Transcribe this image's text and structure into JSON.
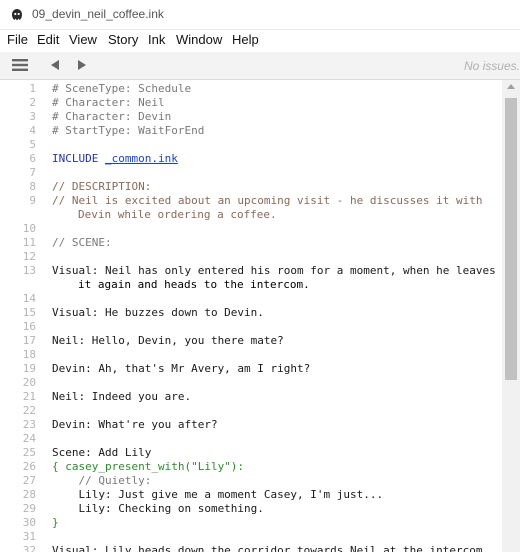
{
  "window": {
    "title": "09_devin_neil_coffee.ink"
  },
  "menu": [
    "File",
    "Edit",
    "View",
    "Story",
    "Ink",
    "Window",
    "Help"
  ],
  "toolbar": {
    "issues_label": "No issues."
  },
  "editor": {
    "lines": [
      {
        "n": "1",
        "segs": [
          {
            "t": "# SceneType: Schedule",
            "c": "c-tag"
          }
        ]
      },
      {
        "n": "2",
        "segs": [
          {
            "t": "# Character: Neil",
            "c": "c-tag"
          }
        ]
      },
      {
        "n": "3",
        "segs": [
          {
            "t": "# Character: Devin",
            "c": "c-tag"
          }
        ]
      },
      {
        "n": "4",
        "segs": [
          {
            "t": "# StartType: WaitForEnd",
            "c": "c-tag"
          }
        ]
      },
      {
        "n": "5",
        "segs": []
      },
      {
        "n": "6",
        "segs": [
          {
            "t": "INCLUDE ",
            "c": "c-include"
          },
          {
            "t": "_common.ink",
            "c": "c-link"
          }
        ]
      },
      {
        "n": "7",
        "segs": []
      },
      {
        "n": "8",
        "segs": [
          {
            "t": "// DESCRIPTION:",
            "c": "c-desc"
          }
        ]
      },
      {
        "n": "9",
        "segs": [
          {
            "t": "// Neil is excited about an upcoming visit - he discusses it with",
            "c": "c-desc"
          }
        ],
        "cont": {
          "t": "Devin while ordering a coffee.",
          "c": "c-desc"
        }
      },
      {
        "n": "10",
        "segs": []
      },
      {
        "n": "11",
        "segs": [
          {
            "t": "// SCENE:",
            "c": "c-comment"
          }
        ]
      },
      {
        "n": "12",
        "segs": []
      },
      {
        "n": "13",
        "segs": [
          {
            "t": "Visual: Neil has only entered his room for a moment, when he leaves",
            "c": ""
          }
        ],
        "cont": {
          "t": "it again and heads to the intercom.",
          "c": ""
        }
      },
      {
        "n": "14",
        "segs": []
      },
      {
        "n": "15",
        "segs": [
          {
            "t": "Visual: He buzzes down to Devin.",
            "c": ""
          }
        ]
      },
      {
        "n": "16",
        "segs": []
      },
      {
        "n": "17",
        "segs": [
          {
            "t": "Neil: Hello, Devin, you there mate?",
            "c": ""
          }
        ]
      },
      {
        "n": "18",
        "segs": []
      },
      {
        "n": "19",
        "segs": [
          {
            "t": "Devin: Ah, that's Mr Avery, am I right?",
            "c": ""
          }
        ]
      },
      {
        "n": "20",
        "segs": []
      },
      {
        "n": "21",
        "segs": [
          {
            "t": "Neil: Indeed you are.",
            "c": ""
          }
        ]
      },
      {
        "n": "22",
        "segs": []
      },
      {
        "n": "23",
        "segs": [
          {
            "t": "Devin: What're you after?",
            "c": ""
          }
        ]
      },
      {
        "n": "24",
        "segs": []
      },
      {
        "n": "25",
        "segs": [
          {
            "t": "Scene: Add Lily",
            "c": ""
          }
        ]
      },
      {
        "n": "26",
        "segs": [
          {
            "t": "{ casey_present_with(\"Lily\"):",
            "c": "c-logic"
          }
        ]
      },
      {
        "n": "27",
        "segs": [
          {
            "t": "    // Quietly:",
            "c": "c-comment"
          }
        ]
      },
      {
        "n": "28",
        "segs": [
          {
            "t": "    Lily: Just give me a moment Casey, I'm just...",
            "c": ""
          }
        ]
      },
      {
        "n": "29",
        "segs": [
          {
            "t": "    Lily: Checking on something.",
            "c": ""
          }
        ]
      },
      {
        "n": "30",
        "segs": [
          {
            "t": "}",
            "c": "c-logic"
          }
        ]
      },
      {
        "n": "31",
        "segs": []
      },
      {
        "n": "32",
        "segs": [
          {
            "t": "Visual: Lily heads down the corridor towards Neil at the intercom",
            "c": ""
          }
        ]
      }
    ]
  }
}
